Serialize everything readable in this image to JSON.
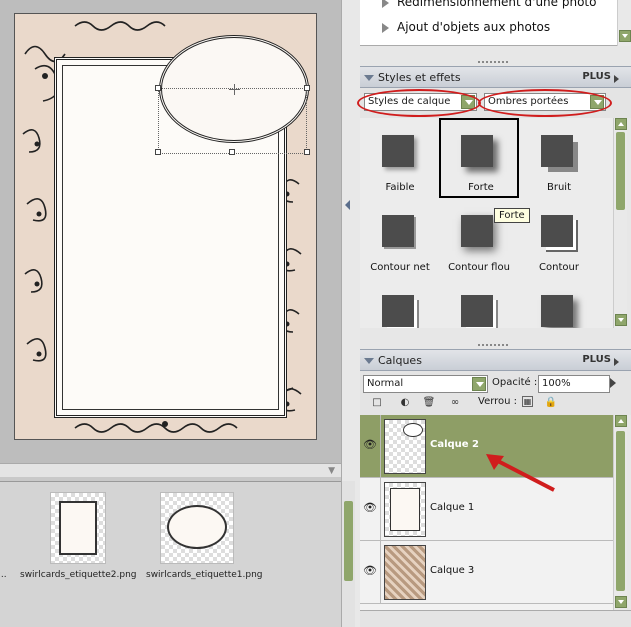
{
  "top_list": {
    "items": [
      "Redimensionnement d'une photo",
      "Ajout d'objets aux photos"
    ]
  },
  "styles_panel": {
    "title": "Styles et effets",
    "more_label": "PLUS",
    "category_select": "Styles de calque",
    "type_select": "Ombres portées",
    "tooltip": "Forte",
    "styles": [
      {
        "label": "Faible"
      },
      {
        "label": "Forte"
      },
      {
        "label": "Bruit"
      },
      {
        "label": "Contour net"
      },
      {
        "label": "Contour flou"
      },
      {
        "label": "Contour"
      },
      {
        "label": ""
      },
      {
        "label": ""
      },
      {
        "label": ""
      }
    ],
    "selected_index": 1
  },
  "layers_panel": {
    "title": "Calques",
    "more_label": "PLUS",
    "blend_mode": "Normal",
    "opacity_label": "Opacité :",
    "opacity_value": "100%",
    "lock_label": "Verrou :",
    "layers": [
      {
        "name": "Calque 2",
        "active": true
      },
      {
        "name": "Calque 1",
        "active": false
      },
      {
        "name": "Calque 3",
        "active": false
      }
    ]
  },
  "bin": {
    "files": [
      "swirlcards_etiquette2.png",
      "swirlcards_etiquette1.png"
    ],
    "truncated_prefix": "..."
  },
  "colors": {
    "accent_green": "#8e9e66",
    "annotation_red": "#d01d1d"
  }
}
